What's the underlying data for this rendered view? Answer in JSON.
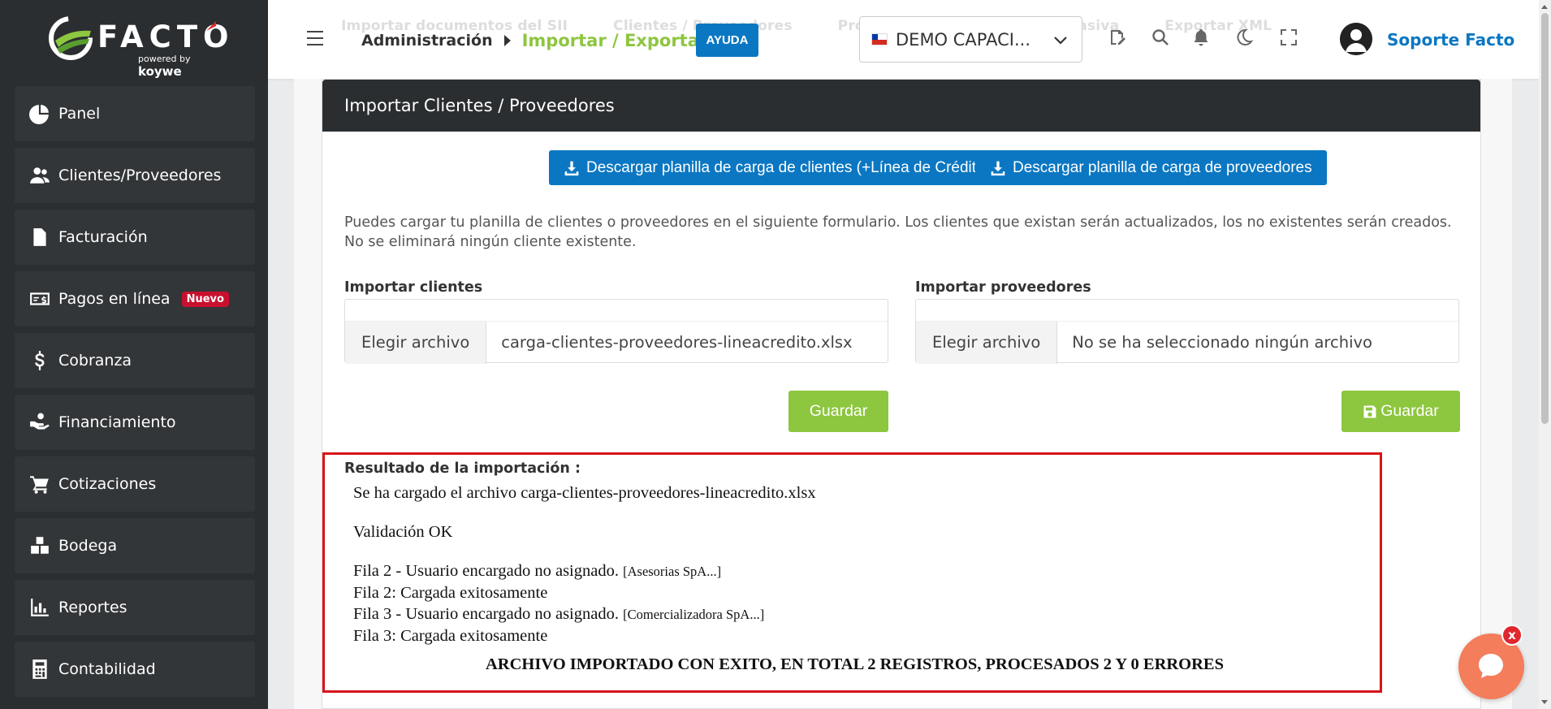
{
  "brand": {
    "name": "FACTO",
    "powered": "powered",
    "by": "by",
    "koywe": "koywe"
  },
  "sidebar": {
    "items": [
      {
        "label": "Panel",
        "icon": "pie-chart-icon"
      },
      {
        "label": "Clientes/Proveedores",
        "icon": "users-icon"
      },
      {
        "label": "Facturación",
        "icon": "document-icon"
      },
      {
        "label": "Pagos en línea",
        "icon": "money-icon",
        "badge": "Nuevo"
      },
      {
        "label": "Cobranza",
        "icon": "dollar-icon"
      },
      {
        "label": "Financiamiento",
        "icon": "hand-coins-icon"
      },
      {
        "label": "Cotizaciones",
        "icon": "cart-icon"
      },
      {
        "label": "Bodega",
        "icon": "boxes-icon"
      },
      {
        "label": "Reportes",
        "icon": "bar-chart-icon"
      },
      {
        "label": "Contabilidad",
        "icon": "calculator-icon"
      }
    ]
  },
  "topbar": {
    "ghost_tabs": [
      "Importar documentos del SII",
      "Clientes / Proveedores",
      "Productos",
      "Información masiva",
      "Exportar XML"
    ],
    "breadcrumb_root": "Administración",
    "breadcrumb_current": "Importar / Exportar",
    "help_label": "AYUDA",
    "company": "DEMO CAPACI...",
    "user_name": "Soporte Facto"
  },
  "card": {
    "title": "Importar Clientes / Proveedores",
    "download_clients": "Descargar planilla de carga de clientes (+Línea de Crédito)",
    "download_suppliers": "Descargar planilla de carga de proveedores",
    "description": "Puedes cargar tu planilla de clientes o proveedores en el siguiente formulario. Los clientes que existan serán actualizados, los no existentes serán creados. No se eliminará ningún cliente existente.",
    "clients": {
      "label": "Importar clientes",
      "choose": "Elegir archivo",
      "filename": "carga-clientes-proveedores-lineacredito.xlsx",
      "save": "Guardar"
    },
    "suppliers": {
      "label": "Importar proveedores",
      "choose": "Elegir archivo",
      "filename": "No se ha seleccionado ningún archivo",
      "save": "Guardar"
    }
  },
  "result": {
    "title": "Resultado de la importación :",
    "loaded": "Se ha cargado el archivo carga-clientes-proveedores-lineacredito.xlsx",
    "validation": "Validación OK",
    "lines": [
      {
        "text": "Fila 2 - Usuario encargado no asignado.",
        "small": "[Asesorias SpA...]"
      },
      {
        "text": "Fila 2: Cargada exitosamente",
        "small": ""
      },
      {
        "text": "Fila 3 - Usuario encargado no asignado.",
        "small": "[Comercializadora SpA...]"
      },
      {
        "text": "Fila 3: Cargada exitosamente",
        "small": ""
      }
    ],
    "summary": "ARCHIVO IMPORTADO CON EXITO, EN TOTAL 2 REGISTROS, PROCESADOS 2 Y 0 ERRORES"
  },
  "chat": {
    "close": "x"
  },
  "colors": {
    "sidebar": "#2b2e30",
    "accent_blue": "#0b77c2",
    "accent_green": "#8dc63f",
    "alert_red": "#d6141a"
  }
}
